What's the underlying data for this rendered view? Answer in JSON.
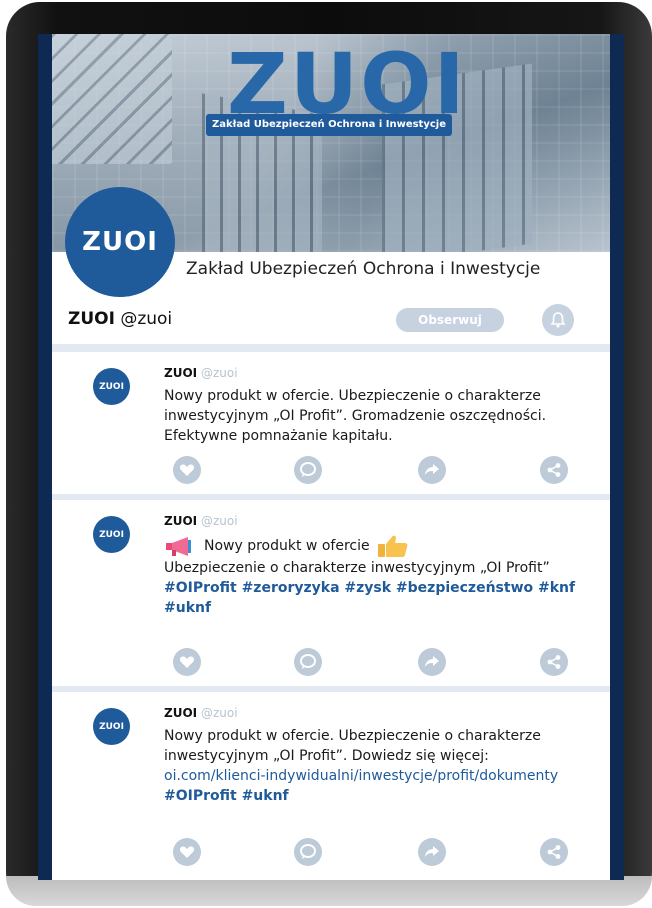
{
  "header": {
    "brand_logo": "ZUOI",
    "brand_subtitle": "Zakład Ubezpieczeń Ochrona i Inwestycje",
    "avatar_text": "ZUOI",
    "company_name": "Zakład Ubezpieczeń Ochrona i Inwestycje",
    "profile_name": "ZUOI",
    "profile_handle": "@zuoi",
    "follow_label": "Obserwuj"
  },
  "posts": [
    {
      "avatar_text": "ZUOI",
      "author": "ZUOI",
      "handle": "@zuoi",
      "text": "Nowy produkt w ofercie. Ubezpieczenie o charakterze inwestycyjnym „OI Profit”.  Gromadzenie oszczędności. Efektywne pomnażanie kapitału."
    },
    {
      "avatar_text": "ZUOI",
      "author": "ZUOI",
      "handle": "@zuoi",
      "headline": "Nowy produkt w ofercie",
      "text": "Ubezpieczenie o charakterze inwestycyjnym „OI Profit”",
      "hashtags": "#OIProfit #zeroryzyka #zysk #bezpieczeństwo #knf #uknf"
    },
    {
      "avatar_text": "ZUOI",
      "author": "ZUOI",
      "handle": "@zuoi",
      "text": "Nowy produkt w ofercie. Ubezpieczenie o charakterze inwestycyjnym „OI Profit”.  Dowiedz się więcej:",
      "link": "oi.com/klienci-indywidualni/inwestycje/profit/dokumenty",
      "hashtags": "#OIProfit #uknf"
    }
  ],
  "icons": [
    "heart-icon",
    "comment-icon",
    "share-arrow-icon",
    "share-network-icon",
    "bell-icon",
    "megaphone-icon",
    "thumbs-up-icon"
  ],
  "colors": {
    "brand": "#1f5a9a",
    "action": "#bdcad8",
    "feed_bg": "#e3e9f1"
  }
}
